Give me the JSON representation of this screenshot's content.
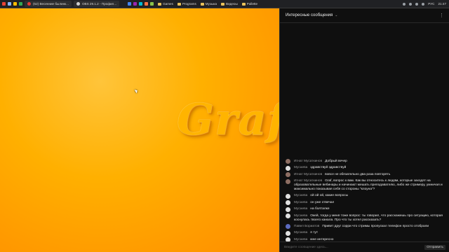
{
  "topbar": {
    "tabs": [
      {
        "label": "(52) Весенние былинк...",
        "fav_color": "#e53935"
      },
      {
        "label": "OBS 29.1.2 - Профил...",
        "fav_color": "#cfcfcf"
      }
    ],
    "bookmarks": [
      "Games",
      "Programs",
      "Музыка",
      "Видеоы",
      "Pallette"
    ],
    "lang": "РУС",
    "clock": "21:47"
  },
  "video": {
    "logo_text": "Graf"
  },
  "chat": {
    "header_title": "Интересные сообщения",
    "input_placeholder": "Введите сообщение здесь...",
    "send_label": "Отправить",
    "messages": [
      {
        "author": "Игнат Мусаткинов",
        "text": "Добрый вечер",
        "avatar_color": "#8d6e63"
      },
      {
        "author": "Мусаева",
        "text": "здравствуй здравствуй",
        "avatar_color": "#e0e0e0"
      },
      {
        "author": "Игнат Мусаткинов",
        "text": "вовсе не обязательно два раза повторять",
        "avatar_color": "#8d6e63"
      },
      {
        "author": "Игнат Мусаткинов",
        "text": "Graf, вопрос к вам. Как вы относитесь к людям, которые заходят на образовательные вебинары и начинают мешать преподавателю, либо же стримеру, умничая и максимально показывая себя со стороны \"клоуна\"?",
        "avatar_color": "#8d6e63"
      },
      {
        "author": "Мусаева",
        "text": "ой ой ой, какие вопросы",
        "avatar_color": "#e0e0e0"
      },
      {
        "author": "Мусаева",
        "text": "он уже отвечал",
        "avatar_color": "#e0e0e0"
      },
      {
        "author": "Мусаева",
        "text": "на болталке",
        "avatar_color": "#e0e0e0"
      },
      {
        "author": "Мусаева",
        "text": "Окей, тогда у меня тоже вопрос: ты говорил, что расскажешь про ситуацию, которая коснулась твоего канала. Про что ты хотел рассказать?",
        "avatar_color": "#e0e0e0"
      },
      {
        "author": "Павел Бориатов",
        "text": "Привет друг сорри что стримы пропускал телефон просто отобрали",
        "avatar_color": "#5c6bc0"
      },
      {
        "author": "Мусаева",
        "text": "я тут",
        "avatar_color": "#e0e0e0"
      },
      {
        "author": "Мусаева",
        "text": "мне интересно",
        "avatar_color": "#e0e0e0"
      }
    ]
  }
}
